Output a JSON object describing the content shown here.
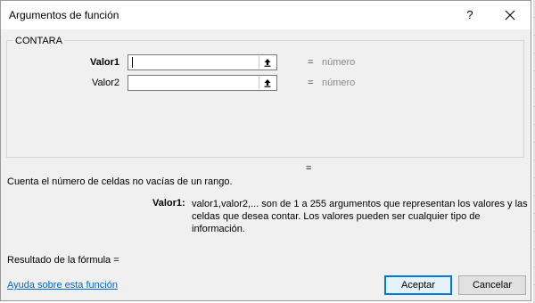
{
  "dialog": {
    "title": "Argumentos de función",
    "help_label": "?",
    "function_name": "CONTARA"
  },
  "arguments": [
    {
      "label": "Valor1",
      "value": "",
      "equals": "=",
      "result": "número"
    },
    {
      "label": "Valor2",
      "value": "",
      "equals": "=",
      "result": "número"
    }
  ],
  "result_equals": "=",
  "description": "Cuenta el número de celdas no vacías de un rango.",
  "arg_description": {
    "label": "Valor1:",
    "text": "valor1,valor2,... son de 1 a 255 argumentos que representan los valores y las celdas que desea contar. Los valores pueden ser cualquier tipo de información."
  },
  "formula_result": "Resultado de la fórmula =",
  "help_link": "Ayuda sobre esta función",
  "buttons": {
    "ok": "Aceptar",
    "cancel": "Cancelar"
  },
  "colors": {
    "accent": "#0078d7",
    "link": "#0066cc",
    "muted": "#8a8a8a"
  }
}
